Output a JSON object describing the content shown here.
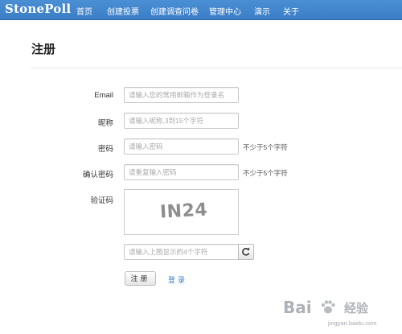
{
  "nav": {
    "brand": "StonePoll",
    "items": [
      "首页",
      "创建投票",
      "创建调查问卷",
      "管理中心",
      "演示",
      "关于"
    ]
  },
  "page": {
    "title": "注册"
  },
  "form": {
    "email": {
      "label": "Email",
      "placeholder": "请输入您的常用邮箱作为登录名"
    },
    "nickname": {
      "label": "昵称",
      "placeholder": "请输入昵称,3到15个字符"
    },
    "password": {
      "label": "密码",
      "placeholder": "请输入密码",
      "hint": "不少于5个字符"
    },
    "confirm_password": {
      "label": "确认密码",
      "placeholder": "请重复输入密码",
      "hint": "不少于5个字符"
    },
    "captcha": {
      "label": "验证码",
      "image_text": "IN24",
      "placeholder": "请输入上图显示的4个字符"
    },
    "submit_label": "注册",
    "login_link": "登录"
  },
  "watermark": {
    "brand": "Bai",
    "brand_cn": "经验",
    "url": "jingyan.baidu.com"
  },
  "colors": {
    "navbar": "#3b7ec6",
    "link": "#3a7fc6"
  }
}
